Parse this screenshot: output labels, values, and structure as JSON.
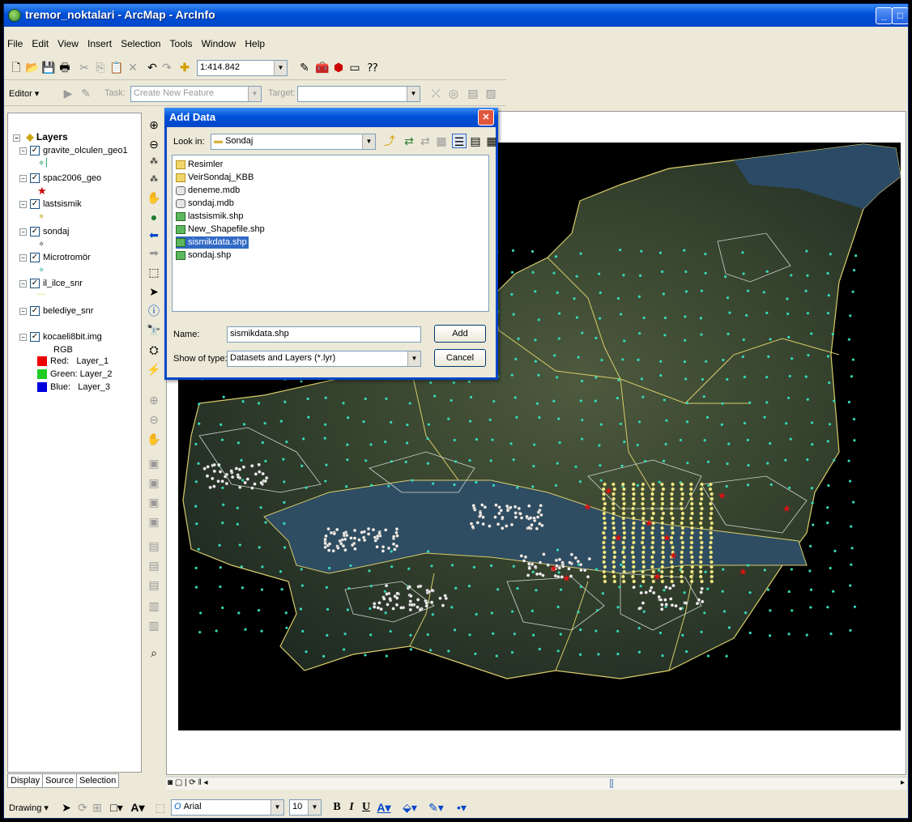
{
  "window": {
    "title": "tremor_noktalari - ArcMap - ArcInfo",
    "min_label": "_",
    "max_label": "□"
  },
  "menu": [
    "File",
    "Edit",
    "View",
    "Insert",
    "Selection",
    "Tools",
    "Window",
    "Help"
  ],
  "standard_toolbar": {
    "scale": "1:414.842"
  },
  "editor_toolbar": {
    "editor_label": "Editor ▾",
    "task_label": "Task:",
    "task_value": "Create New Feature",
    "target_label": "Target:",
    "target_value": ""
  },
  "toc": {
    "root": "Layers",
    "layers": [
      {
        "name": "gravite_olculen_geo1",
        "checked": "✓",
        "symbol": "⋄ ▏"
      },
      {
        "name": "spac2006_geo",
        "checked": "✓",
        "symbol": "★"
      },
      {
        "name": "lastsismik",
        "checked": "✓",
        "symbol": "⋄"
      },
      {
        "name": "sondaj",
        "checked": "✓",
        "symbol": "⋄"
      },
      {
        "name": "Microtromör",
        "checked": "✓",
        "symbol": "⋄"
      },
      {
        "name": "il_ilce_snr",
        "checked": "✓",
        "symbol": "—"
      },
      {
        "name": "belediye_snr",
        "checked": "✓",
        "symbol": ""
      },
      {
        "name": "kocaeli8bit.img",
        "checked": "✓",
        "symbol": ""
      }
    ],
    "raster": {
      "rgb": "RGB",
      "red": "Red:   Layer_1",
      "green": "Green: Layer_2",
      "blue": "Blue:   Layer_3"
    },
    "tabs": [
      "Display",
      "Source",
      "Selection"
    ]
  },
  "dialog": {
    "title": "Add Data",
    "look_in_label": "Look in:",
    "look_in_value": "Sondaj",
    "files": [
      {
        "name": "Resimler",
        "type": "folder"
      },
      {
        "name": "VeirSondaj_KBB",
        "type": "folder"
      },
      {
        "name": "deneme.mdb",
        "type": "mdb"
      },
      {
        "name": "sondaj.mdb",
        "type": "mdb"
      },
      {
        "name": "lastsismik.shp",
        "type": "shp"
      },
      {
        "name": "New_Shapefile.shp",
        "type": "shp"
      },
      {
        "name": "sismikdata.shp",
        "type": "shp",
        "selected": true
      },
      {
        "name": "sondaj.shp",
        "type": "shp"
      }
    ],
    "name_label": "Name:",
    "name_value": "sismikdata.shp",
    "type_label": "Show of type:",
    "type_value": "Datasets and Layers (*.lyr)",
    "add_label": "Add",
    "cancel_label": "Cancel"
  },
  "drawing_toolbar": {
    "drawing_label": "Drawing ▾",
    "font": "Arial",
    "size": "10",
    "bold": "B",
    "italic": "I",
    "underline": "U"
  },
  "colors": {
    "title_blue": "#0050d8",
    "map_dark": "#1f2a22",
    "boundary_yellow": "#e6d86a",
    "point_cyan": "#35d9b8",
    "selected_bg": "#316ac5"
  }
}
